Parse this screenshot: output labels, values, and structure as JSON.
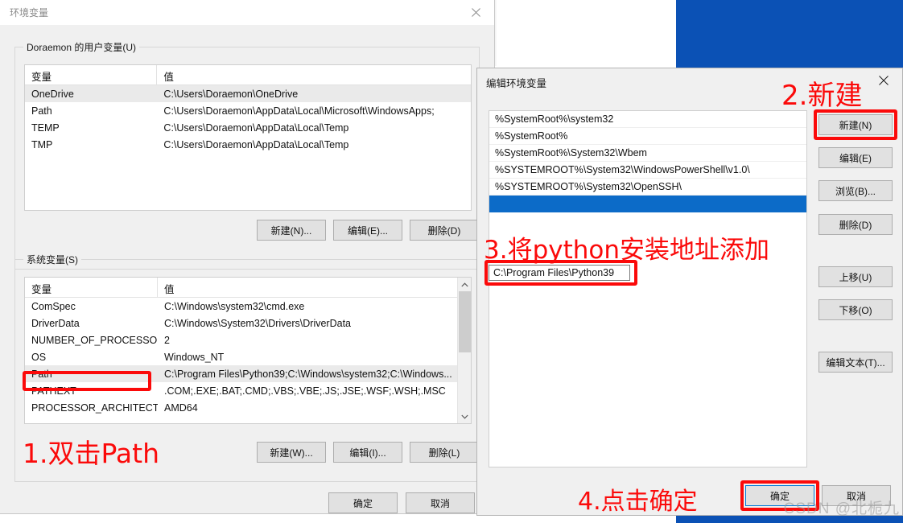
{
  "desktop": {
    "blue_color": "#0b51b5"
  },
  "env_window": {
    "title": "环境变量",
    "close_icon": "close-icon",
    "user_group_legend": "Doraemon 的用户变量(U)",
    "system_group_legend": "系统变量(S)",
    "columns": [
      "变量",
      "值"
    ],
    "user_rows": [
      {
        "name": "OneDrive",
        "value": "C:\\Users\\Doraemon\\OneDrive",
        "selected": true
      },
      {
        "name": "Path",
        "value": "C:\\Users\\Doraemon\\AppData\\Local\\Microsoft\\WindowsApps;",
        "selected": false
      },
      {
        "name": "TEMP",
        "value": "C:\\Users\\Doraemon\\AppData\\Local\\Temp",
        "selected": false
      },
      {
        "name": "TMP",
        "value": "C:\\Users\\Doraemon\\AppData\\Local\\Temp",
        "selected": false
      }
    ],
    "user_buttons": [
      {
        "label": "新建(N)..."
      },
      {
        "label": "编辑(E)..."
      },
      {
        "label": "删除(D)"
      }
    ],
    "system_rows": [
      {
        "name": "ComSpec",
        "value": "C:\\Windows\\system32\\cmd.exe",
        "selected": false
      },
      {
        "name": "DriverData",
        "value": "C:\\Windows\\System32\\Drivers\\DriverData",
        "selected": false
      },
      {
        "name": "NUMBER_OF_PROCESSORS",
        "value": "2",
        "selected": false
      },
      {
        "name": "OS",
        "value": "Windows_NT",
        "selected": false
      },
      {
        "name": "Path",
        "value": "C:\\Program Files\\Python39;C:\\Windows\\system32;C:\\Windows...",
        "selected": true
      },
      {
        "name": "PATHEXT",
        "value": ".COM;.EXE;.BAT;.CMD;.VBS;.VBE;.JS;.JSE;.WSF;.WSH;.MSC",
        "selected": false
      },
      {
        "name": "PROCESSOR_ARCHITECT...",
        "value": "AMD64",
        "selected": false
      }
    ],
    "system_buttons": [
      {
        "label": "新建(W)..."
      },
      {
        "label": "编辑(I)..."
      },
      {
        "label": "删除(L)"
      }
    ],
    "footer_buttons": [
      {
        "label": "确定"
      },
      {
        "label": "取消"
      }
    ],
    "scroll_up_icon": "chevron-up-icon",
    "scroll_down_icon": "chevron-down-icon"
  },
  "edit_dialog": {
    "title": "编辑环境变量",
    "close_icon": "close-icon",
    "path_entries": [
      "%SystemRoot%\\system32",
      "%SystemRoot%",
      "%SystemRoot%\\System32\\Wbem",
      "%SYSTEMROOT%\\System32\\WindowsPowerShell\\v1.0\\",
      "%SYSTEMROOT%\\System32\\OpenSSH\\"
    ],
    "new_entry_value": "C:\\Program Files\\Python39",
    "side_buttons": [
      {
        "label": "新建(N)"
      },
      {
        "label": "编辑(E)"
      },
      {
        "label": "浏览(B)..."
      },
      {
        "label": "删除(D)"
      },
      {
        "label": "上移(U)"
      },
      {
        "label": "下移(O)"
      },
      {
        "label": "编辑文本(T)..."
      }
    ],
    "footer_buttons": [
      {
        "label": "确定"
      },
      {
        "label": "取消"
      }
    ]
  },
  "annotations": [
    {
      "id": "step1",
      "text": "1.双击Path"
    },
    {
      "id": "step2",
      "text": "2.新建"
    },
    {
      "id": "step3",
      "text": "3.将python安装地址添加"
    },
    {
      "id": "step4",
      "text": "4.点击确定"
    }
  ],
  "watermark": {
    "text": "CSDN @北栀九"
  },
  "colors": {
    "annotation_red": "#fb0a0a",
    "selection_blue": "#0c6bc8",
    "focus_blue": "#0078d7"
  }
}
